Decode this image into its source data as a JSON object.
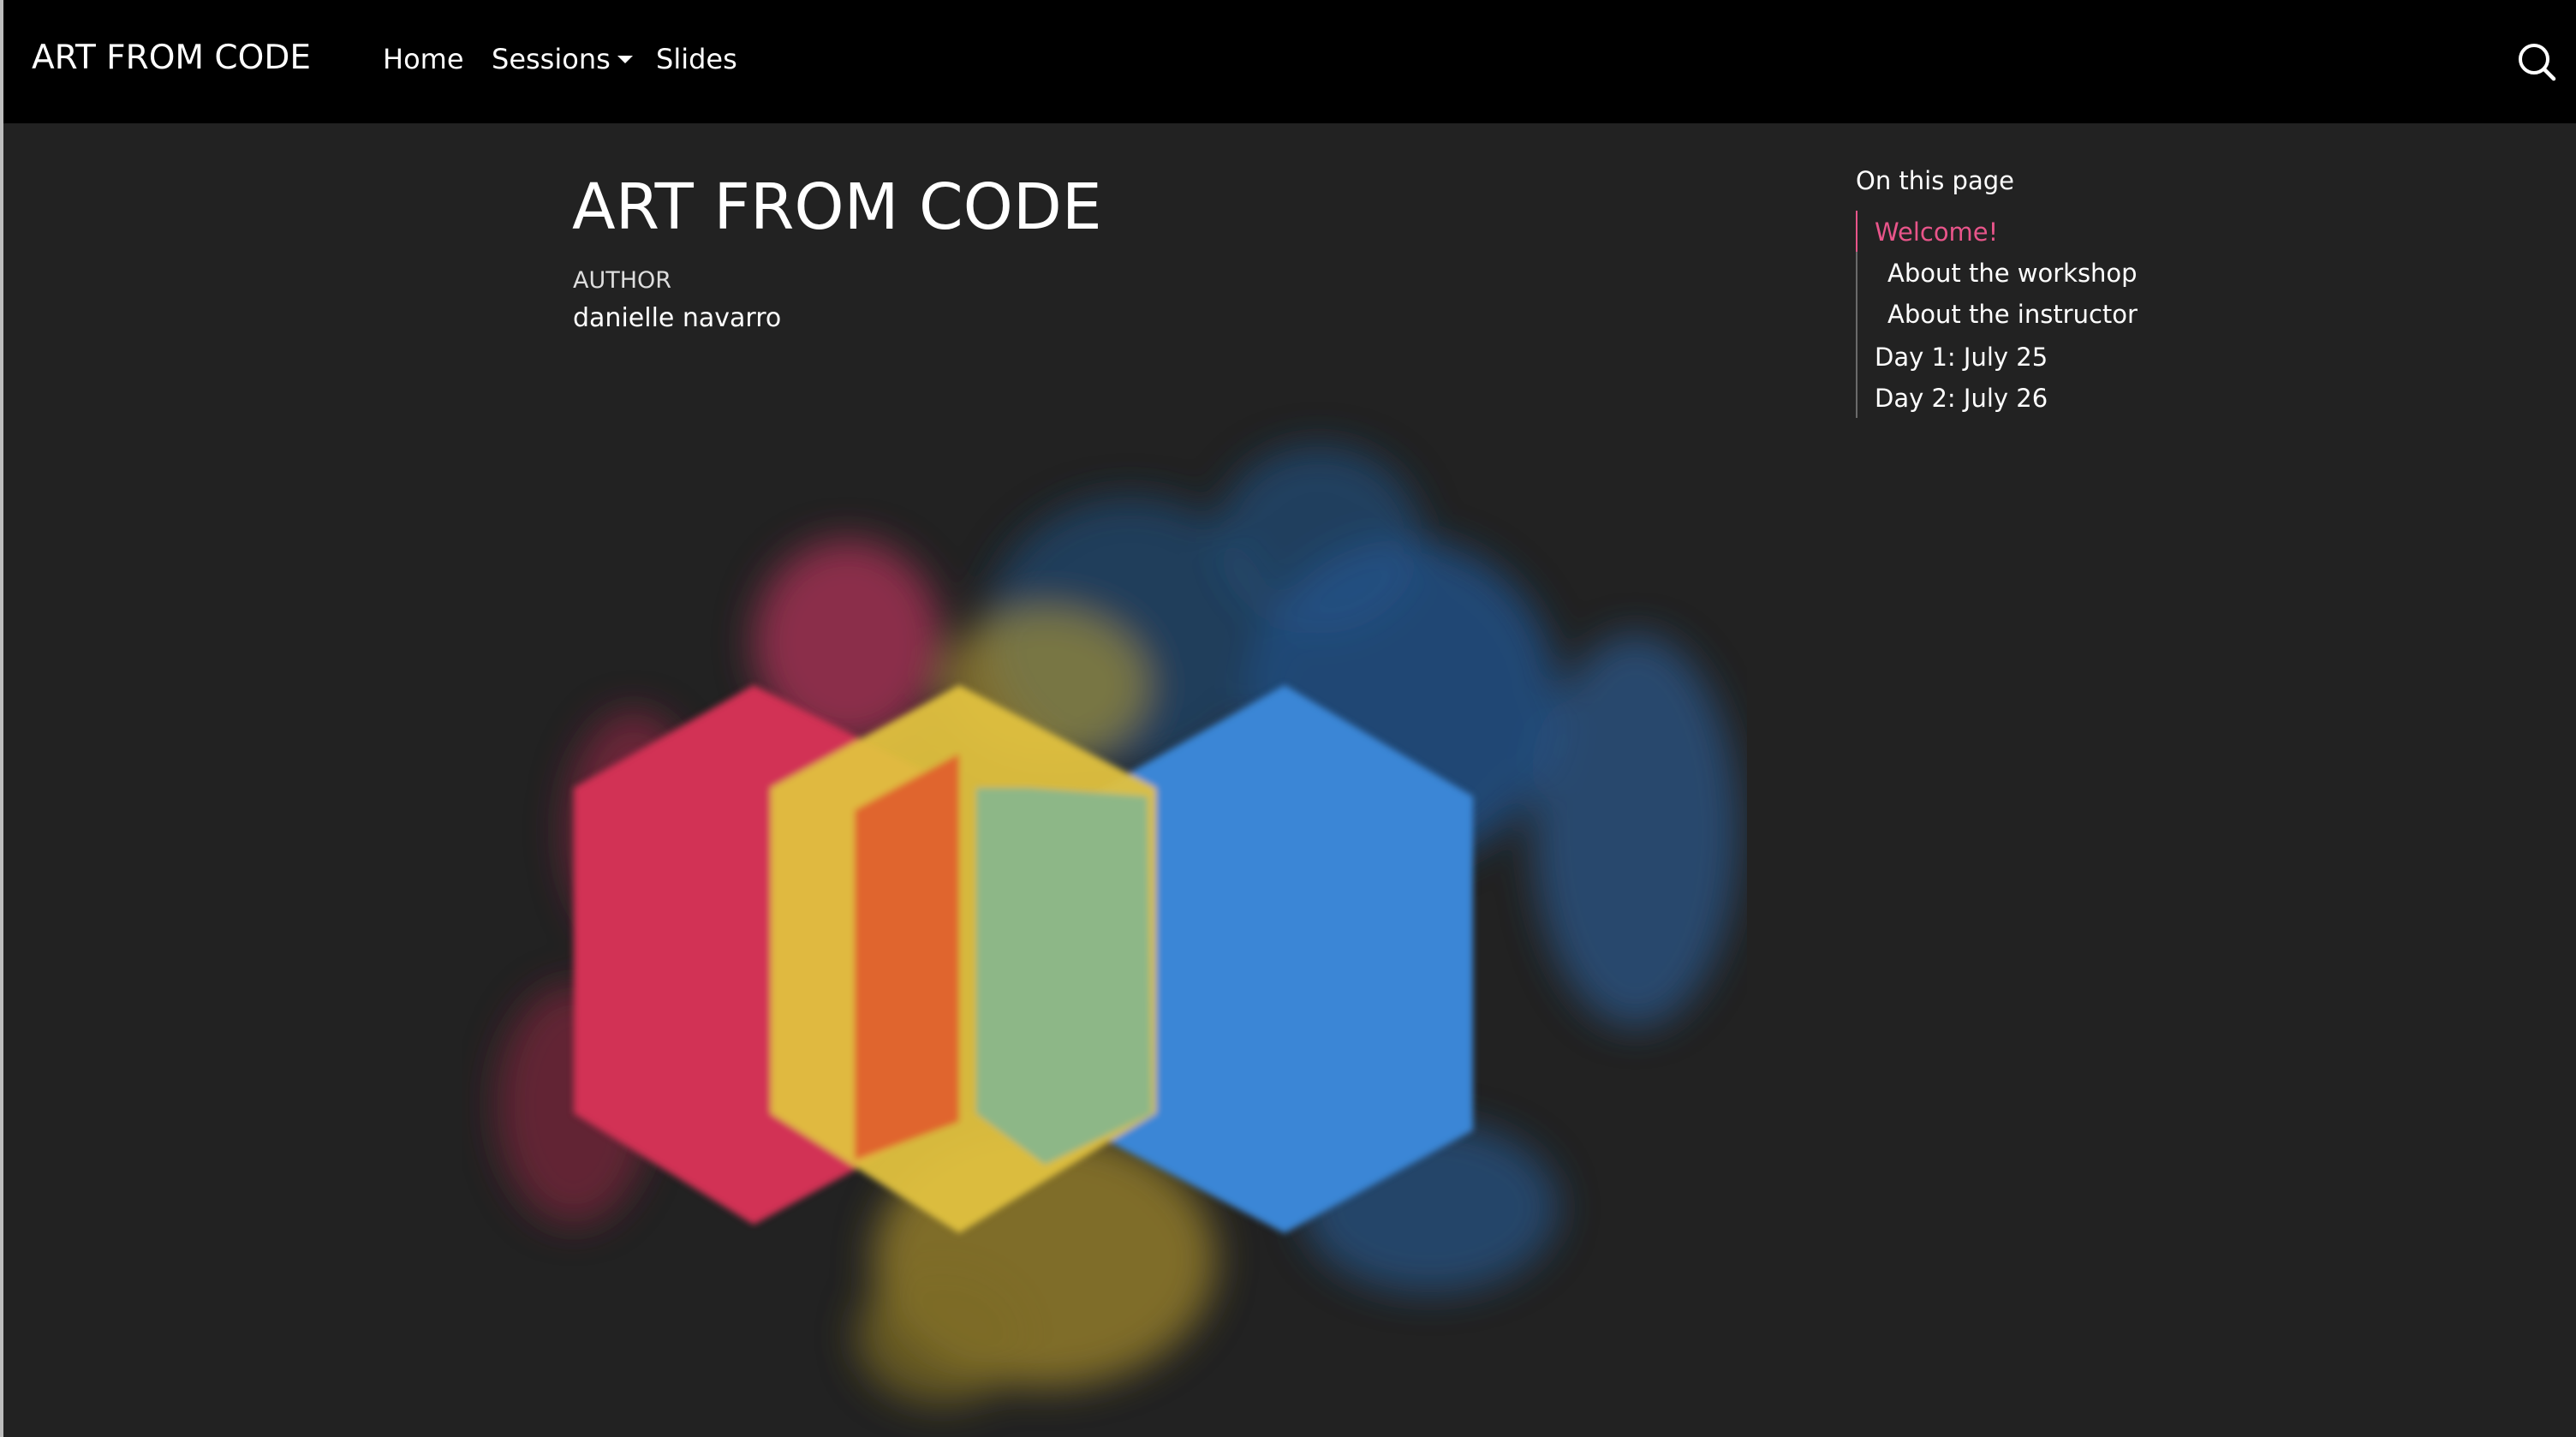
{
  "navbar": {
    "brand": "ART FROM CODE",
    "links": [
      "Home",
      "Sessions",
      "Slides"
    ],
    "search_icon": "search-icon"
  },
  "main": {
    "title": "ART FROM CODE",
    "author_label": "AUTHOR",
    "author_name": "danielle navarro"
  },
  "toc": {
    "title": "On this page",
    "items": [
      "Welcome!",
      "About the workshop",
      "About the instructor",
      "Day 1: July 25",
      "Day 2: July 26"
    ],
    "active_index": 0
  },
  "colors": {
    "navbar_bg": "#000000",
    "page_bg": "#222222",
    "accent": "#e8558a",
    "art_red": "#d23355",
    "art_orange": "#e0652f",
    "art_yellow": "#e0c13e",
    "art_green": "#8db787",
    "art_blue": "#3a86d6"
  }
}
